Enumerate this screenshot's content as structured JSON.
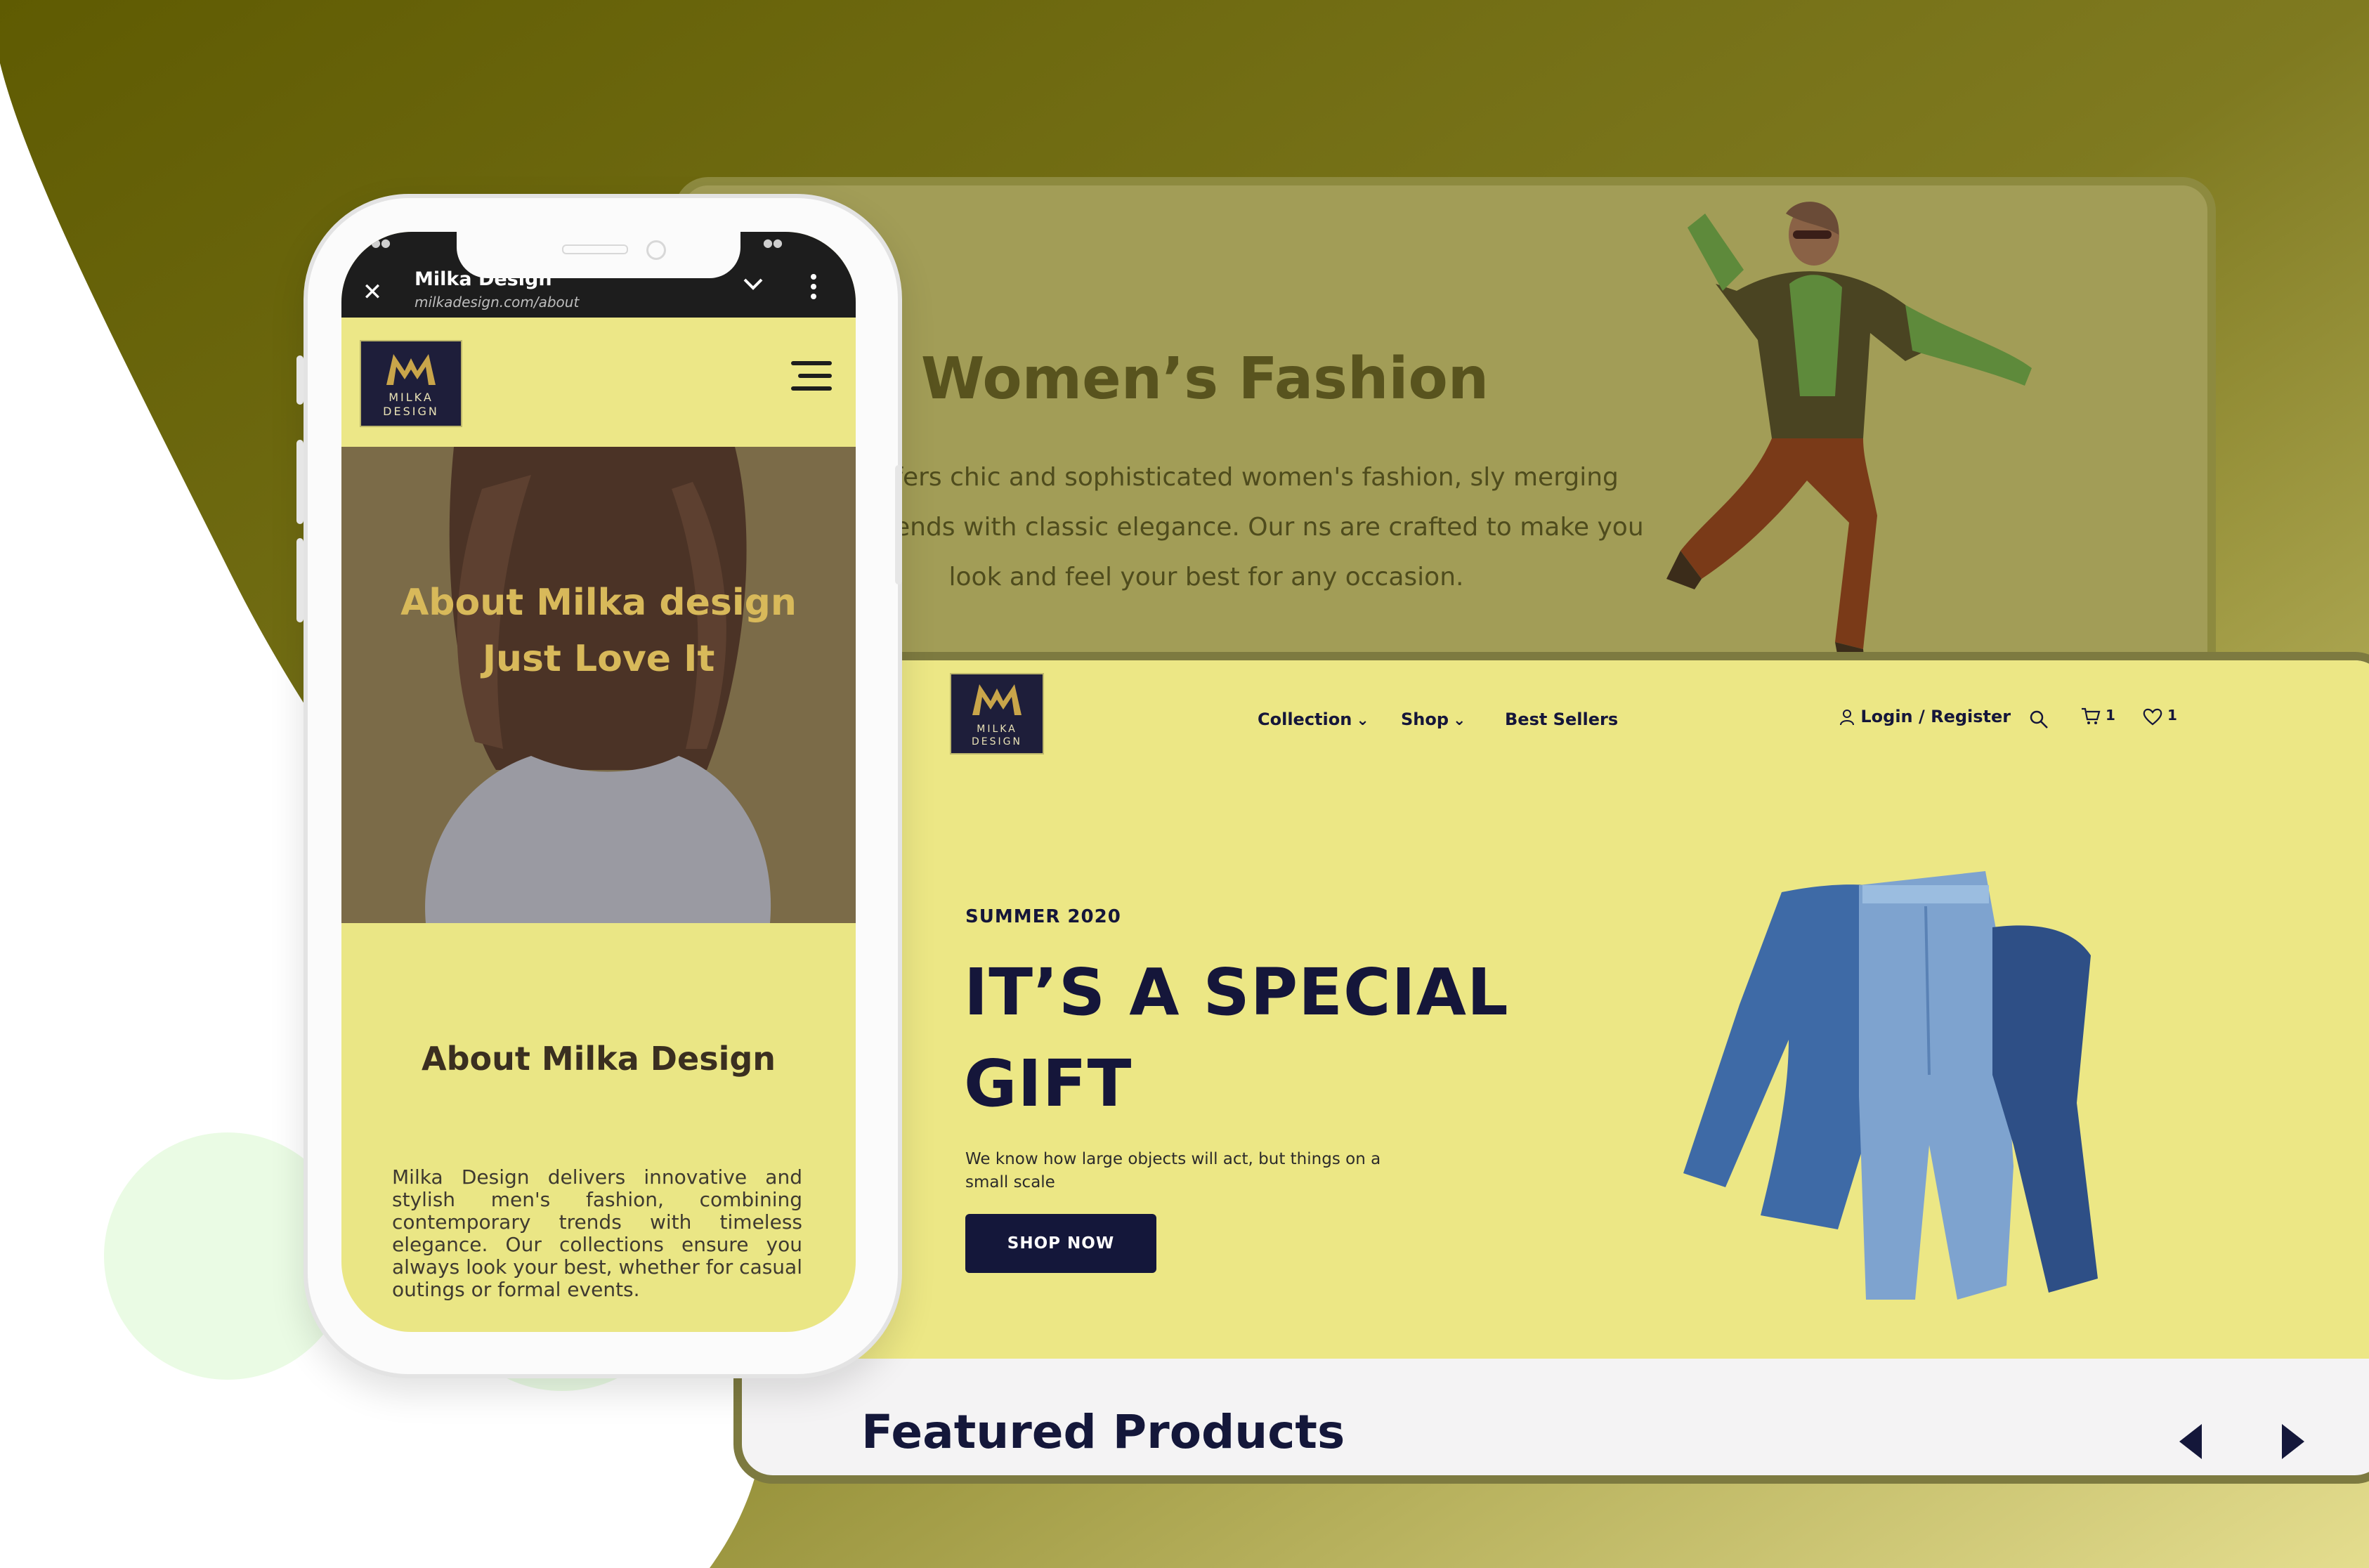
{
  "colors": {
    "olive_dark": "#635f08",
    "olive_light": "#bab45c",
    "site_yellow": "#ece785",
    "navy": "#14173a",
    "gold": "#d8b95a"
  },
  "desktop": {
    "section_title": "Women’s Fashion",
    "section_text": "esign offers chic and sophisticated women's fashion, sly merging modern trends with classic elegance. Our ns are crafted to make you look and feel your best for any occasion.",
    "logo": {
      "line1": "MILKA",
      "line2": "DESIGN"
    },
    "nav": {
      "collection": "Collection",
      "shop": "Shop",
      "best_sellers": "Best Sellers",
      "login": "Login / Register",
      "cart_count": "1",
      "wishlist_count": "1"
    },
    "icons": [
      "user-icon",
      "search-icon",
      "cart-icon",
      "heart-icon",
      "chevron-down-icon"
    ],
    "hero": {
      "eyebrow": "SUMMER 2020",
      "headline": "IT’S A SPECIAL GIFT",
      "subtext": "We know how large objects will act, but things on a small scale",
      "cta": "SHOP NOW"
    },
    "featured_title": "Featured Products"
  },
  "mobile": {
    "tab_title": "Milka Design",
    "url": "milkadesign.com/about",
    "logo": {
      "line1": "MILKA",
      "line2": "DESIGN"
    },
    "hero_line1": "About Milka design",
    "hero_line2": "Just Love It",
    "about_title": "About Milka Design",
    "about_text": "Milka Design delivers innovative and stylish men's fashion, combining contemporary trends with timeless elegance. Our collections ensure you always look your best, whether for casual outings or formal events."
  }
}
